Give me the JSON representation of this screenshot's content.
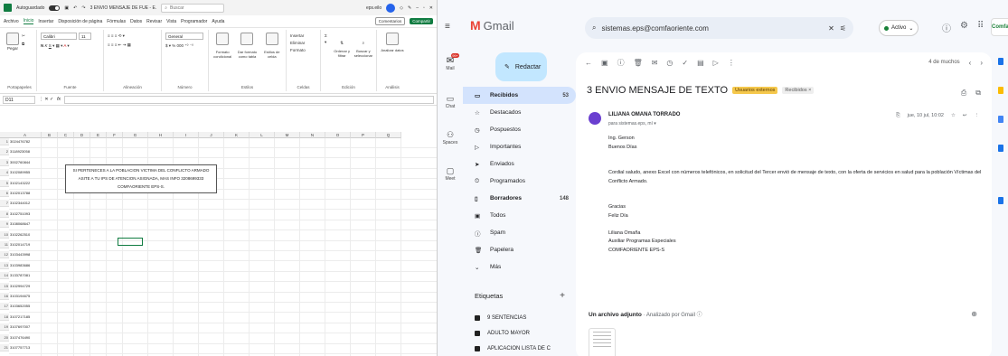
{
  "excel": {
    "autosave": "Autoguardado",
    "filename": "3 ENVIO MENSAJE DE FUE - E.",
    "search": "Buscar",
    "user": "eps.eilo",
    "menu": [
      "Archivo",
      "Inicio",
      "Insertar",
      "Disposición de página",
      "Fórmulas",
      "Datos",
      "Revisar",
      "Vista",
      "Programador",
      "Ayuda"
    ],
    "comments": "Comentarios",
    "share": "Compartir",
    "ribbon": {
      "clipboard": {
        "label": "Portapapeles",
        "paste": "Pegar"
      },
      "font": {
        "label": "Fuente",
        "name": "Calibri",
        "size": "11"
      },
      "align": {
        "label": "Alineación"
      },
      "number": {
        "label": "Número",
        "format": "General"
      },
      "styles": {
        "label": "Estilos",
        "cond": "Formato condicional",
        "table": "Dar formato como tabla",
        "cell": "Estilos de celda"
      },
      "cells": {
        "label": "Celdas",
        "insert": "Insertar",
        "delete": "Eliminar",
        "format": "Formato"
      },
      "edit": {
        "label": "Edición",
        "sort": "Ordenar y filtrar",
        "find": "Buscar y seleccionar"
      },
      "analysis": {
        "label": "Análisis",
        "analyze": "Analizar datos"
      }
    },
    "namebox": "D11",
    "fx": "fx",
    "columns": [
      "A",
      "B",
      "C",
      "D",
      "E",
      "F",
      "G",
      "H",
      "I",
      "J",
      "K",
      "L",
      "M",
      "N",
      "O",
      "P",
      "Q"
    ],
    "rows": [
      {
        "n": "1",
        "a": "3024476782"
      },
      {
        "n": "2",
        "a": "3118923058"
      },
      {
        "n": "3",
        "a": "3002760844"
      },
      {
        "n": "4",
        "a": "3102089955"
      },
      {
        "n": "5",
        "a": "3102143222"
      },
      {
        "n": "6",
        "a": "3102013788"
      },
      {
        "n": "7",
        "a": "3102344012"
      },
      {
        "n": "8",
        "a": "3102751093"
      },
      {
        "n": "9",
        "a": "3108068647"
      },
      {
        "n": "10",
        "a": "3102262510"
      },
      {
        "n": "11",
        "a": "3102014719"
      },
      {
        "n": "12",
        "a": "3103443998"
      },
      {
        "n": "13",
        "a": "3103983686"
      },
      {
        "n": "14",
        "a": "3133787081"
      },
      {
        "n": "15",
        "a": "3102994729"
      },
      {
        "n": "16",
        "a": "3103194675"
      },
      {
        "n": "17",
        "a": "3103652055"
      },
      {
        "n": "18",
        "a": "3107217185"
      },
      {
        "n": "19",
        "a": "3107697007"
      },
      {
        "n": "20",
        "a": "3107476490"
      },
      {
        "n": "21",
        "a": "3107757713"
      }
    ],
    "message": [
      "SI PERTENECES A LA POBLACION VICTIMA DEL CONFLICTO ARMADO",
      "ASITE A TU IPS DE ATENCION ASIGNADA, MAS INFO 3208699333",
      "COMFAORIENTE EPS-S."
    ]
  },
  "gmail": {
    "logo": "Gmail",
    "search": "sistemas.eps@comfaoriente.com",
    "status": "Activo",
    "brand": "Comfaoriente",
    "avatar": "P",
    "rail": {
      "mail": "Mail",
      "chat": "Chat",
      "spaces": "Spaces",
      "meet": "Meet",
      "badge": "99+"
    },
    "compose": "Redactar",
    "nav": [
      {
        "label": "Recibidos",
        "count": "53",
        "bold": true,
        "active": true,
        "icon": "inbox-icon",
        "glyph": "▭"
      },
      {
        "label": "Destacados",
        "count": "",
        "icon": "star-icon",
        "glyph": "☆"
      },
      {
        "label": "Pospuestos",
        "count": "",
        "icon": "clock-icon",
        "glyph": "◷"
      },
      {
        "label": "Importantes",
        "count": "",
        "icon": "important-icon",
        "glyph": "▷"
      },
      {
        "label": "Enviados",
        "count": "",
        "icon": "send-icon",
        "glyph": "➤"
      },
      {
        "label": "Programados",
        "count": "",
        "icon": "schedule-icon",
        "glyph": "⏲"
      },
      {
        "label": "Borradores",
        "count": "148",
        "bold": true,
        "icon": "draft-icon",
        "glyph": "▯"
      },
      {
        "label": "Todos",
        "count": "",
        "icon": "all-mail-icon",
        "glyph": "▣"
      },
      {
        "label": "Spam",
        "count": "",
        "icon": "spam-icon",
        "glyph": "ⓘ"
      },
      {
        "label": "Papelera",
        "count": "",
        "icon": "trash-icon",
        "glyph": "🗑"
      },
      {
        "label": "Más",
        "count": "",
        "icon": "chevron-down-icon",
        "glyph": "⌄"
      }
    ],
    "labels_title": "Etiquetas",
    "labels": [
      "9 SENTENCIAS",
      "ADULTO MAYOR",
      "APLICACION LISTA DE C"
    ],
    "pagecount": "4 de muchos",
    "subject": "3 ENVIO MENSAJE DE TEXTO",
    "tag_external": "Usuarios externos",
    "tag_inbox": "Recibidos ×",
    "sender": "LILIANA OMANA TORRADO",
    "to": "para sistemas.eps, mí ▾",
    "date": "jue, 10 jul, 10:02",
    "body": [
      "Ing. Gerson",
      "Buenos Días",
      "",
      "",
      "Cordial saludo, anexo Excel con números telefónicos, en solicitud del Tercer envió de mensaje de texto, con la oferta de servicios en salud para la población Víctimas del Conflicto Armado.",
      "",
      "",
      "Gracias",
      "Feliz Día",
      "",
      "Liliana Omaña",
      "Auxiliar Programas Especiales",
      "COMFAORIENTE EPS-S"
    ],
    "attachment": "Un archivo adjunto",
    "analyzed": " · Analizado por Gmail ⓘ"
  }
}
